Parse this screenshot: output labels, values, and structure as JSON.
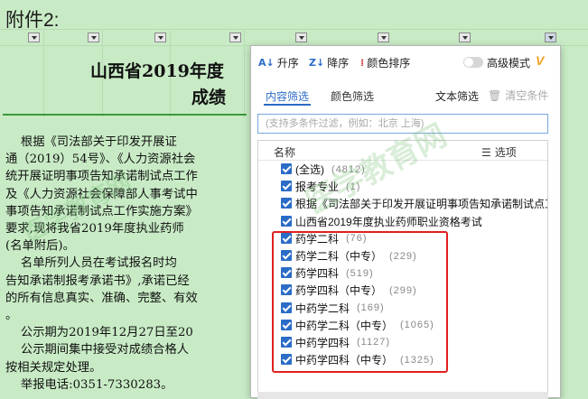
{
  "sheet": {
    "attachment_label": "附件2:",
    "doc_title_line1": "山西省2019年度",
    "doc_title_line2": "成绩",
    "body_text": "    根据《司法部关于印发开展证\n通（2019）54号》、《人力资源社会\n统开展证明事项告知承诺制试点工作\n及《人力资源社会保障部人事考试中\n事项告知承诺制试点工作实施方案》\n要求,现将我省2019年度执业药师\n(名单附后)。\n    名单所列人员在考试报名时均\n告知承诺制报考承诺书》,承诺已经\n的所有信息真实、准确、完整、有效\n。\n    公示期为2019年12月27日至20\n    公示期间集中接受对成绩合格人\n按相关规定处理。\n    举报电话:0351-7330283。"
  },
  "panel": {
    "sort_asc": "升序",
    "sort_desc": "降序",
    "color_sort": "颜色排序",
    "advanced_mode": "高级模式",
    "tab_content": "内容筛选",
    "tab_color": "颜色筛选",
    "text_filter": "文本筛选",
    "clear": "清空条件",
    "search_placeholder": "(支持多条件过滤，例如：北京 上海)",
    "list_header_name": "名称",
    "list_header_options": "选项",
    "items": [
      {
        "label": "(全选)",
        "count": "(4812)",
        "checked": true
      },
      {
        "label": "报考专业",
        "count": "(1)",
        "checked": true
      },
      {
        "label": "根据《司法部关于印发开展证明事项告知承诺制试点工",
        "count": "",
        "checked": true
      },
      {
        "label": "山西省2019年度执业药师职业资格考试",
        "count": "",
        "checked": true
      },
      {
        "label": "药学二科",
        "count": "(76)",
        "checked": true
      },
      {
        "label": "药学二科（中专）",
        "count": "(229)",
        "checked": true
      },
      {
        "label": "药学四科",
        "count": "(519)",
        "checked": true
      },
      {
        "label": "药学四科（中专）",
        "count": "(299)",
        "checked": true
      },
      {
        "label": "中药学二科",
        "count": "(169)",
        "checked": true
      },
      {
        "label": "中药学二科（中专）",
        "count": "(1065)",
        "checked": true
      },
      {
        "label": "中药学四科",
        "count": "(1127)",
        "checked": true
      },
      {
        "label": "中药学四科（中专）",
        "count": "(1325)",
        "checked": true
      }
    ]
  },
  "colors": {
    "accent": "#2b6cc7",
    "highlight": "#e02020",
    "sheet_bg": "#c8ebc5"
  }
}
